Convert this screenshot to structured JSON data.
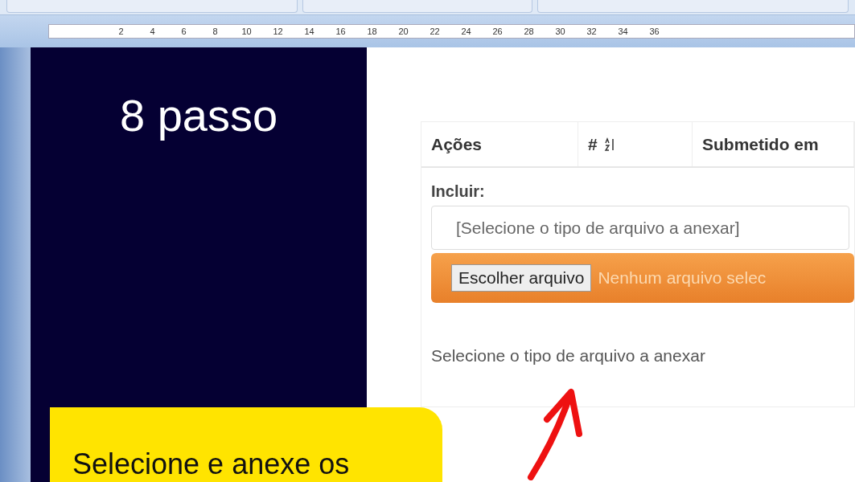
{
  "ruler": {
    "labels": [
      "2",
      "4",
      "6",
      "8",
      "10",
      "12",
      "14",
      "16",
      "18",
      "20",
      "22",
      "24",
      "26",
      "28",
      "30",
      "32",
      "34",
      "36"
    ]
  },
  "slide": {
    "title": "8 passo",
    "callout": "Selecione e anexe os"
  },
  "form": {
    "columns": [
      "Ações",
      "#",
      "Submetido em"
    ],
    "include_label": "Incluir:",
    "select": {
      "placeholder": "[Selecione o tipo de arquivo a anexar]"
    },
    "file_button": "Escolher arquivo",
    "file_status": "Nenhum arquivo selec",
    "hint": "Selecione o tipo de arquivo a anexar"
  }
}
